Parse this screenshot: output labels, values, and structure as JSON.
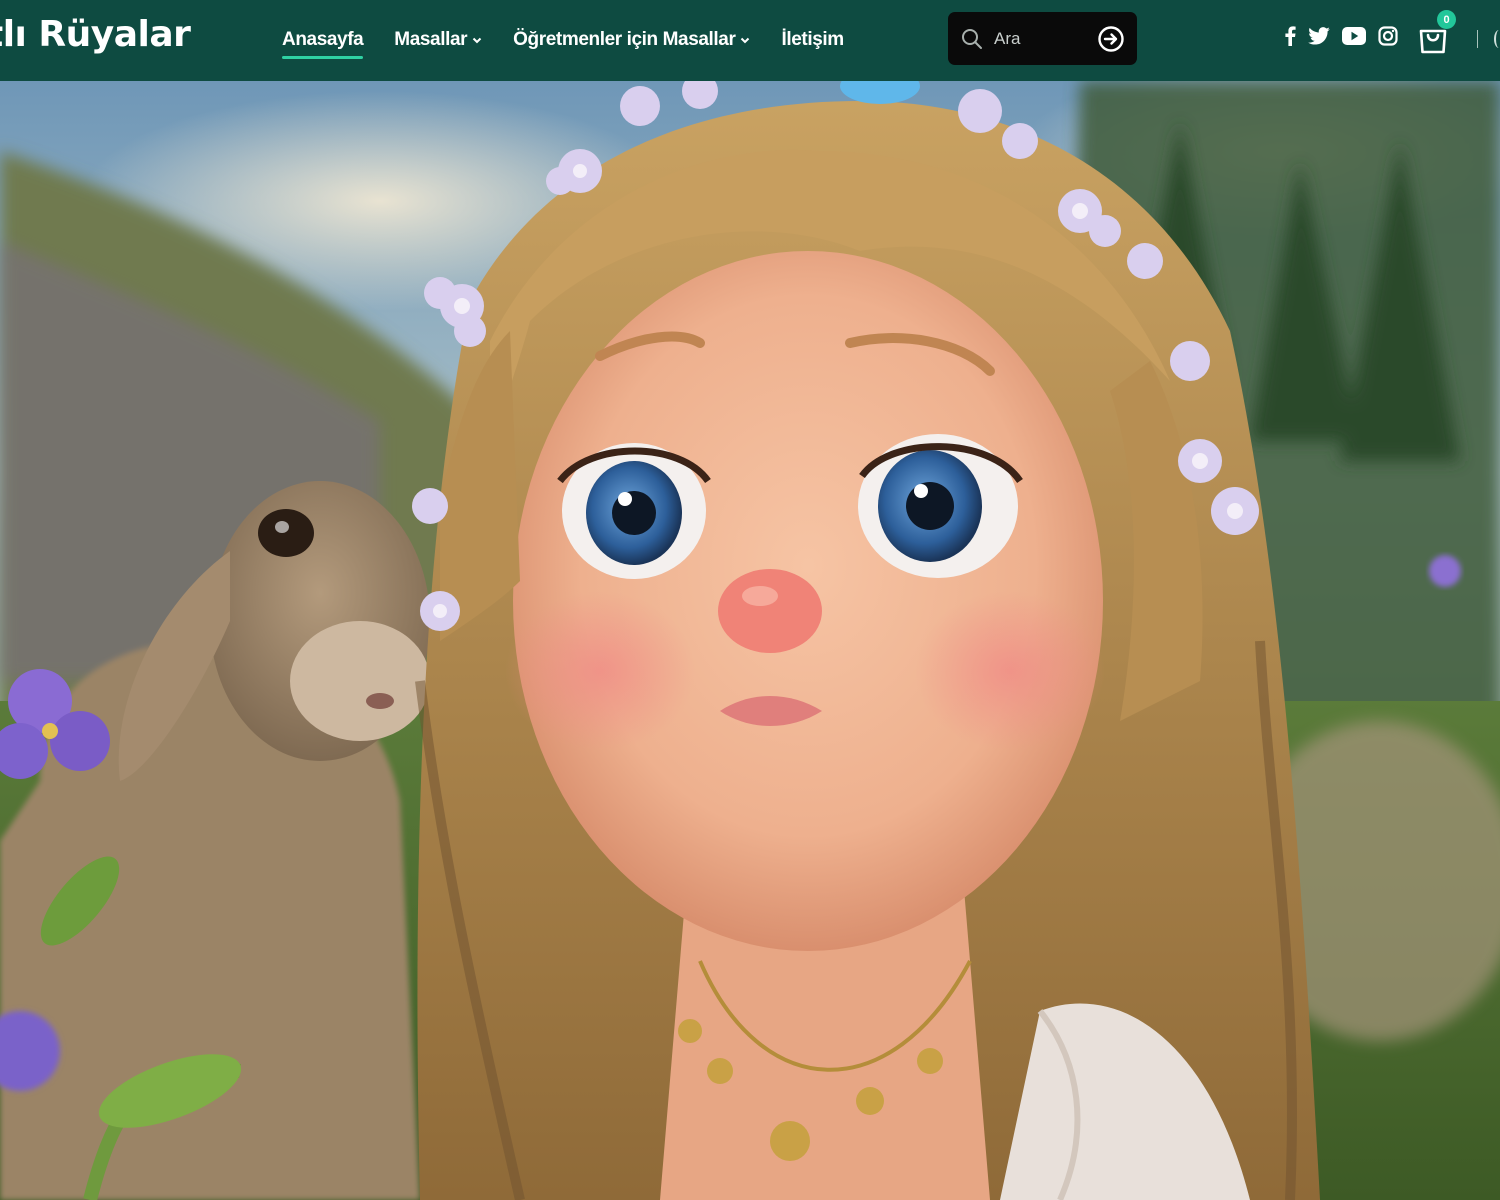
{
  "header": {
    "logo_text": "tlı Rüyalar",
    "nav": [
      {
        "label": "Anasayfa",
        "active": true,
        "has_dropdown": false
      },
      {
        "label": "Masallar",
        "active": false,
        "has_dropdown": true
      },
      {
        "label": "Öğretmenler için Masallar",
        "active": false,
        "has_dropdown": true
      },
      {
        "label": "İletişim",
        "active": false,
        "has_dropdown": false
      }
    ],
    "search": {
      "placeholder": "Ara",
      "value": ""
    },
    "social_icons": [
      "facebook-icon",
      "twitter-icon",
      "youtube-icon",
      "instagram-icon"
    ],
    "cart": {
      "count": "0",
      "icon": "shopping-bag-icon"
    }
  },
  "hero": {
    "subject": "animated girl with flower crown and goat in a flower meadow"
  },
  "colors": {
    "header_bg": "#0e4b41",
    "accent": "#2fd1a3",
    "search_bg": "#0a0a0a"
  }
}
